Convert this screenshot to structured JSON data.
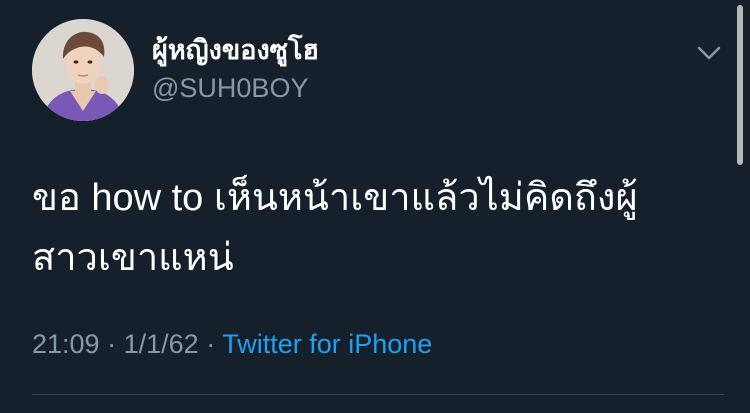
{
  "tweet": {
    "display_name": "ผู้หญิงของซูโฮ",
    "handle": "@SUH0BOY",
    "text_line_1": "ขอ how to เห็นหน้าเขาแล้วไม่คิดถึงผู้",
    "text_line_2": "สาวเขาแหน่",
    "time": "21:09",
    "separator": "·",
    "date": "1/1/62",
    "source": "Twitter for iPhone"
  },
  "icons": {
    "menu": "chevron-down-icon",
    "avatar": "profile-photo"
  },
  "colors": {
    "background": "#15202b",
    "text_primary": "#ffffff",
    "text_secondary": "#8899a6",
    "link": "#1da1f2",
    "divider": "#38444d"
  }
}
